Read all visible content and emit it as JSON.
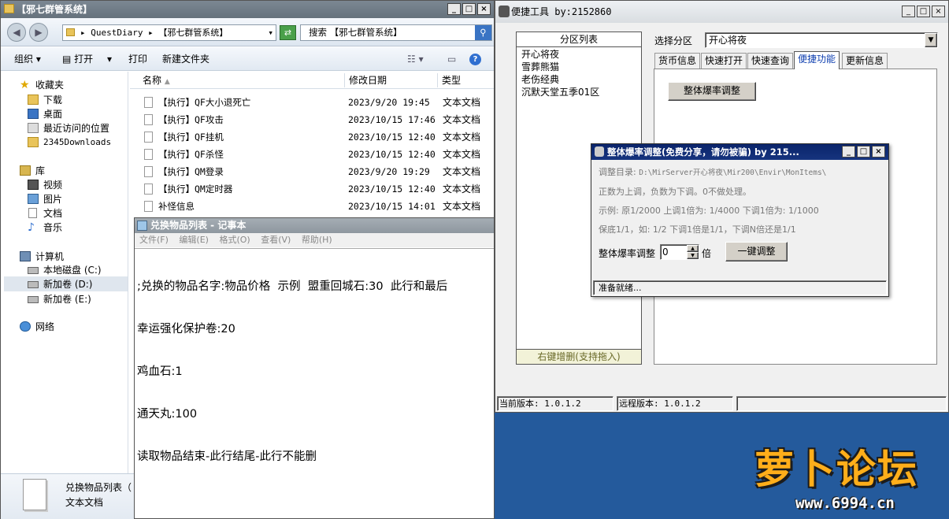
{
  "explorer": {
    "title": "【邪七群管系统】",
    "address": [
      "QuestDiary",
      "【邪七群管系统】"
    ],
    "search_placeholder": "搜索 【邪七群管系统】",
    "toolbar": {
      "organize": "组织",
      "open": "打开",
      "print": "打印",
      "new_folder": "新建文件夹"
    },
    "nav": {
      "favorites": "收藏夹",
      "downloads": "下载",
      "desktop": "桌面",
      "recent": "最近访问的位置",
      "d2345": "2345Downloads",
      "library": "库",
      "videos": "视频",
      "pictures": "图片",
      "documents": "文档",
      "music": "音乐",
      "computer": "计算机",
      "drive_c": "本地磁盘 (C:)",
      "drive_d": "新加卷 (D:)",
      "drive_e": "新加卷 (E:)",
      "network": "网络"
    },
    "columns": {
      "name": "名称",
      "date": "修改日期",
      "type": "类型"
    },
    "files": [
      {
        "name": "【执行】QF大小退死亡",
        "date": "2023/9/20 19:45",
        "type": "文本文档"
      },
      {
        "name": "【执行】QF攻击",
        "date": "2023/10/15 17:46",
        "type": "文本文档"
      },
      {
        "name": "【执行】QF挂机",
        "date": "2023/10/15 12:40",
        "type": "文本文档"
      },
      {
        "name": "【执行】QF杀怪",
        "date": "2023/10/15 12:40",
        "type": "文本文档"
      },
      {
        "name": "【执行】QM登录",
        "date": "2023/9/20 19:29",
        "type": "文本文档"
      },
      {
        "name": "【执行】QM定时器",
        "date": "2023/10/15 12:40",
        "type": "文本文档"
      },
      {
        "name": "补怪信息",
        "date": "2023/10/15 14:01",
        "type": "文本文档"
      }
    ],
    "details": {
      "name": "兑换物品列表（",
      "type": "文本文档"
    }
  },
  "notepad": {
    "title": "兑换物品列表 - 记事本",
    "menu": [
      "文件(F)",
      "编辑(E)",
      "格式(O)",
      "查看(V)",
      "帮助(H)"
    ],
    "lines": [
      ";兑换的物品名字:物品价格  示例  盟重回城石:30  此行和最后",
      "幸运强化保护卷:20",
      "鸡血石:1",
      "通天丸:100",
      "读取物品结束-此行结尾-此行不能删"
    ]
  },
  "tool": {
    "title": "便捷工具  by:2152860",
    "partition_header": "分区列表",
    "partitions": [
      "开心将夜",
      "雪葬熊猫",
      "老伤经典",
      "沉默天堂五季01区"
    ],
    "partition_footer": "右键增删(支持拖入)",
    "select_label": "选择分区",
    "select_value": "开心将夜",
    "tabs": [
      "货币信息",
      "快速打开",
      "快速查询",
      "便捷功能",
      "更新信息"
    ],
    "active_tab": 3,
    "action_button": "整体爆率调整",
    "status_current": "当前版本: 1.0.1.2",
    "status_remote": "远程版本: 1.0.1.2"
  },
  "dialog": {
    "title": "整体爆率调整(免费分享，请勿被骗)  by 215...",
    "dir_label": "调整目录:",
    "dir_value": "D:\\MirServer开心将夜\\Mir200\\Envir\\MonItems\\",
    "hint1": "正数为上调，负数为下调。0不做处理。",
    "hint2": "示例: 原1/2000 上调1倍为: 1/4000 下调1倍为: 1/1000",
    "hint3": "保底1/1，如: 1/2 下调1倍是1/1，下调N倍还是1/1",
    "field_label": "整体爆率调整",
    "field_value": "0",
    "unit": "倍",
    "button": "一键调整",
    "status": "准备就绪..."
  },
  "watermark": {
    "text": "萝卜论坛",
    "url": "www.6994.cn"
  }
}
